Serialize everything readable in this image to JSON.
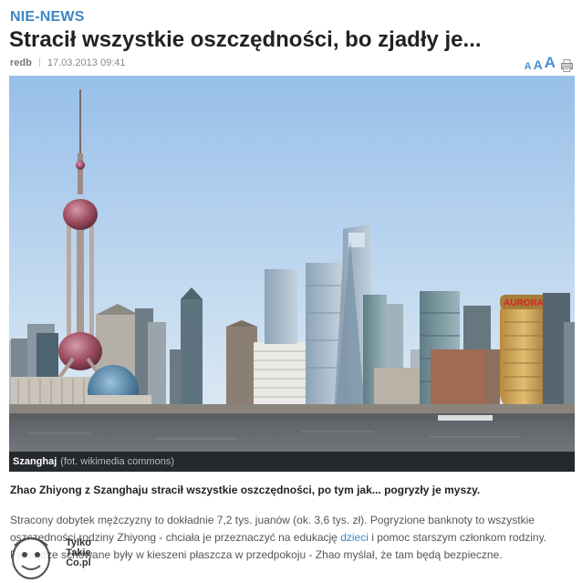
{
  "header": {
    "section": "NIE-NEWS",
    "title": "Stracił wszystkie oszczędności, bo zjadły je...",
    "author": "redb",
    "date": "17.03.2013 09:41"
  },
  "tools": {
    "font_small": "A",
    "font_medium": "A",
    "font_large": "A",
    "print_icon": "printer-icon"
  },
  "photo": {
    "place": "Szanghaj",
    "credit": "(fot. wikimedia commons)",
    "sign_text": "AURORA"
  },
  "article": {
    "lead": "Zhao Zhiyong z Szanghaju stracił wszystkie oszczędności, po tym jak... pogryzły je myszy.",
    "p1_before": "Stracony dobytek mężczyzny to dokładnie 7,2 tys. juanów (ok. 3,6 tys. zł). Pogryzione banknoty to wszystkie oszczędności rodziny Zhiyong - chciała je przeznaczyć na edukację ",
    "p1_link": "dzieci",
    "p1_after": " i pomoc starszym członkom rodziny. Pieniądze schowane były w kieszeni płaszcza w przedpokoju - Zhao myślał, że tam będą bezpieczne."
  },
  "watermark": {
    "line1": "Tylko",
    "line2": "Takie",
    "line3": "Co.pl"
  },
  "colors": {
    "accent": "#3f86c4",
    "sky_top": "#9dc3ea",
    "sky_bottom": "#e4eef6",
    "water": "#6c7176"
  }
}
